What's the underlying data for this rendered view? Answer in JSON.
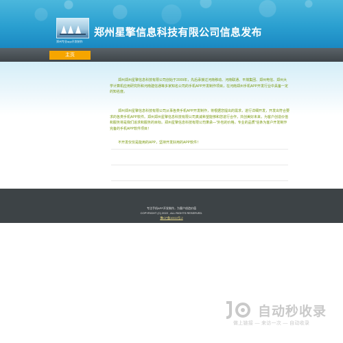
{
  "header": {
    "title": "郑州星擎信息科技有限公司信息发布",
    "slogan": "郑州专业app开发制作"
  },
  "nav": {
    "items": [
      {
        "label": "主页"
      }
    ]
  },
  "content": {
    "paragraphs": [
      "郑州郑州星擎信息科技有限公司创始于2009年，先后承接过河南移动、河南联通、平煤集团、郑州电信、郑州大学计算机应用研究所和河南建信通等多家知名公司的手机APP开发制作项目，在河南郑州手机APP开发行业中具备一定的知名度。",
      "郑州郑州星擎信息科技有限公司从事各类手机APP开发制作，将根据您提出的需求，进行详细开发，开发出符合要求的各类手机APP软件。郑州郑州星擎信息科技有限公司真诚希望能够和您进行合作，共创美好未来，为客户创造价值和服务将是我们追求和服务的目标。郑州星擎信息科技有限公司秉承—“外包的价格，专业的品质”信条为客户开发制作完备的手机APP软件项目！",
      "不开发仅仅是能用的APP，坚持开发好用的APP软件！"
    ]
  },
  "footer": {
    "line1": "专注手机APP开发制作，为客户创造价值",
    "line2": "COPYRIGHT (C) 2022 , ALL RIGHTS RESERVED.",
    "icp": "豫ICP备10010号-2"
  },
  "watermark": {
    "title": "自动秒收录",
    "subtitle": "做上链接 — 来访一次 — 自动收录"
  },
  "colors": {
    "header_blue": "#2a9fd0",
    "nav_dark": "#3e4549",
    "nav_active": "#f6a500",
    "text_green": "#7a9a10",
    "footer_bg": "#3d4346"
  }
}
